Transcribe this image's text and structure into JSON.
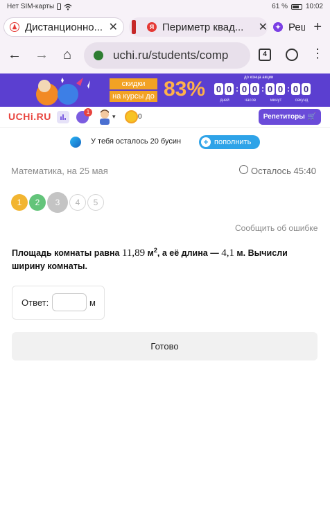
{
  "status_bar": {
    "carrier": "Нет SIM-карты",
    "battery": "61 %",
    "time": "10:02"
  },
  "tabs": [
    {
      "title": "Дистанционно...",
      "close": "✕"
    },
    {
      "title": "Периметр квад...",
      "close": "✕"
    },
    {
      "title": "Реш"
    }
  ],
  "new_tab": "+",
  "address_bar": {
    "url": "uchi.ru/students/comp",
    "tab_count": "4"
  },
  "promo": {
    "label_top": "скидки",
    "label_bottom": "на курсы до",
    "percent": "83%",
    "timer_title": "до конца акции",
    "timer_digits": [
      "0",
      "0",
      "0",
      "0",
      "0",
      "0",
      "0",
      "0"
    ],
    "timer_units": [
      "дней",
      "часов",
      "минут",
      "секунд"
    ]
  },
  "header": {
    "logo": "UCHi.RU",
    "chat_badge": "1",
    "coin_count": "0",
    "tutors_button": "Репетиторы"
  },
  "beads": {
    "text": "У тебя осталось 20 бусин",
    "topup_button": "пополнить"
  },
  "lesson": {
    "subject": "Математика, на 25 мая",
    "time_left": "Осталось 45:40"
  },
  "steps": [
    "1",
    "2",
    "3",
    "4",
    "5"
  ],
  "report_link": "Сообщить об ошибке",
  "question": {
    "part1": "Площадь комнаты равна ",
    "area": "11,89",
    "unit_area": " м",
    "unit_sup": "2",
    "part2": ", а её длина — ",
    "length": "4,1",
    "part3": " м. Вычисли ширину комнаты."
  },
  "answer": {
    "label": "Ответ:",
    "value": "",
    "unit": "м"
  },
  "ready_button": "Готово",
  "colors": {
    "promo_bg": "#5b3fd0",
    "accent": "#6a4bd9",
    "logo_red": "#e8433d",
    "topup_blue": "#2ea3e8"
  }
}
